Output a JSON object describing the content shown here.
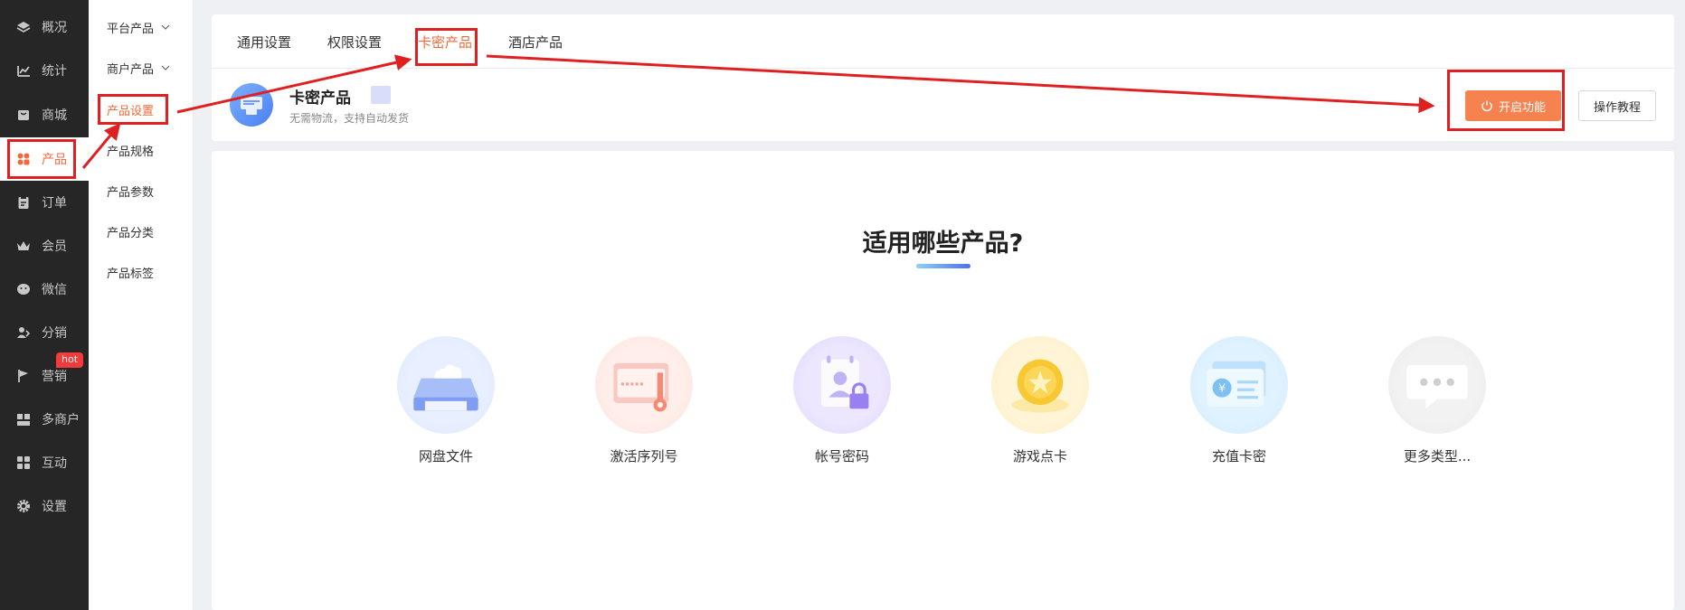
{
  "sidebar": {
    "items": [
      {
        "label": "概况",
        "icon": "layers-icon"
      },
      {
        "label": "统计",
        "icon": "chart-icon"
      },
      {
        "label": "商城",
        "icon": "store-icon"
      },
      {
        "label": "产品",
        "icon": "grid-icon",
        "active": true
      },
      {
        "label": "订单",
        "icon": "clipboard-icon"
      },
      {
        "label": "会员",
        "icon": "crown-icon"
      },
      {
        "label": "微信",
        "icon": "wechat-icon"
      },
      {
        "label": "分销",
        "icon": "user-share-icon"
      },
      {
        "label": "营销",
        "icon": "flag-icon"
      },
      {
        "label": "多商户",
        "icon": "multi-store-icon"
      },
      {
        "label": "互动",
        "icon": "interact-icon"
      },
      {
        "label": "设置",
        "icon": "gear-icon"
      }
    ],
    "hot_badge": "hot"
  },
  "subnav": {
    "items": [
      {
        "label": "平台产品",
        "expandable": true
      },
      {
        "label": "商户产品",
        "expandable": true
      },
      {
        "label": "产品设置",
        "active": true
      },
      {
        "label": "产品规格"
      },
      {
        "label": "产品参数"
      },
      {
        "label": "产品分类"
      },
      {
        "label": "产品标签"
      }
    ]
  },
  "tabs": [
    "通用设置",
    "权限设置",
    "卡密产品",
    "酒店产品"
  ],
  "active_tab": "卡密产品",
  "product": {
    "title": "卡密产品",
    "subtitle": "无需物流，支持自动发货"
  },
  "buttons": {
    "enable": "开启功能",
    "tutorial": "操作教程"
  },
  "main": {
    "title": "适用哪些产品?",
    "types": [
      {
        "label": "网盘文件",
        "icon": "cloud-drive-icon"
      },
      {
        "label": "激活序列号",
        "icon": "serial-key-icon"
      },
      {
        "label": "帐号密码",
        "icon": "account-lock-icon"
      },
      {
        "label": "游戏点卡",
        "icon": "game-coin-icon"
      },
      {
        "label": "充值卡密",
        "icon": "recharge-card-icon"
      },
      {
        "label": "更多类型...",
        "icon": "more-chat-icon"
      }
    ]
  },
  "colors": {
    "accent": "#f26a3b",
    "sidebar_bg": "#262626",
    "annotation": "#e02020",
    "enable_button": "#f5824f"
  }
}
